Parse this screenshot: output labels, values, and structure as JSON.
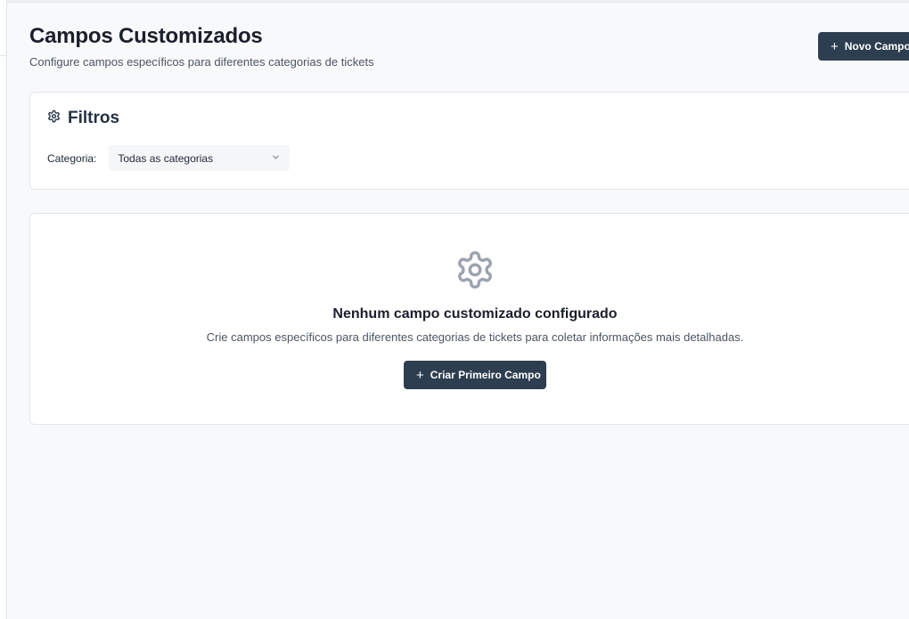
{
  "header": {
    "title": "Campos Customizados",
    "subtitle": "Configure campos específicos para diferentes categorias de tickets",
    "new_field_button": "Novo Campo"
  },
  "filters": {
    "title": "Filtros",
    "category_label": "Categoria:",
    "category_selected": "Todas as categorias"
  },
  "empty_state": {
    "title": "Nenhum campo customizado configurado",
    "description": "Crie campos específicos para diferentes categorias de tickets para coletar informações mais detalhadas.",
    "button": "Criar Primeiro Campo"
  },
  "icons": {
    "plus": "plus-icon",
    "gear": "gear-icon",
    "chevron": "chevron-down-icon"
  },
  "colors": {
    "primary_button": "#2d3e50",
    "background": "#f8f9fb",
    "icon_muted": "#9ca3af"
  }
}
